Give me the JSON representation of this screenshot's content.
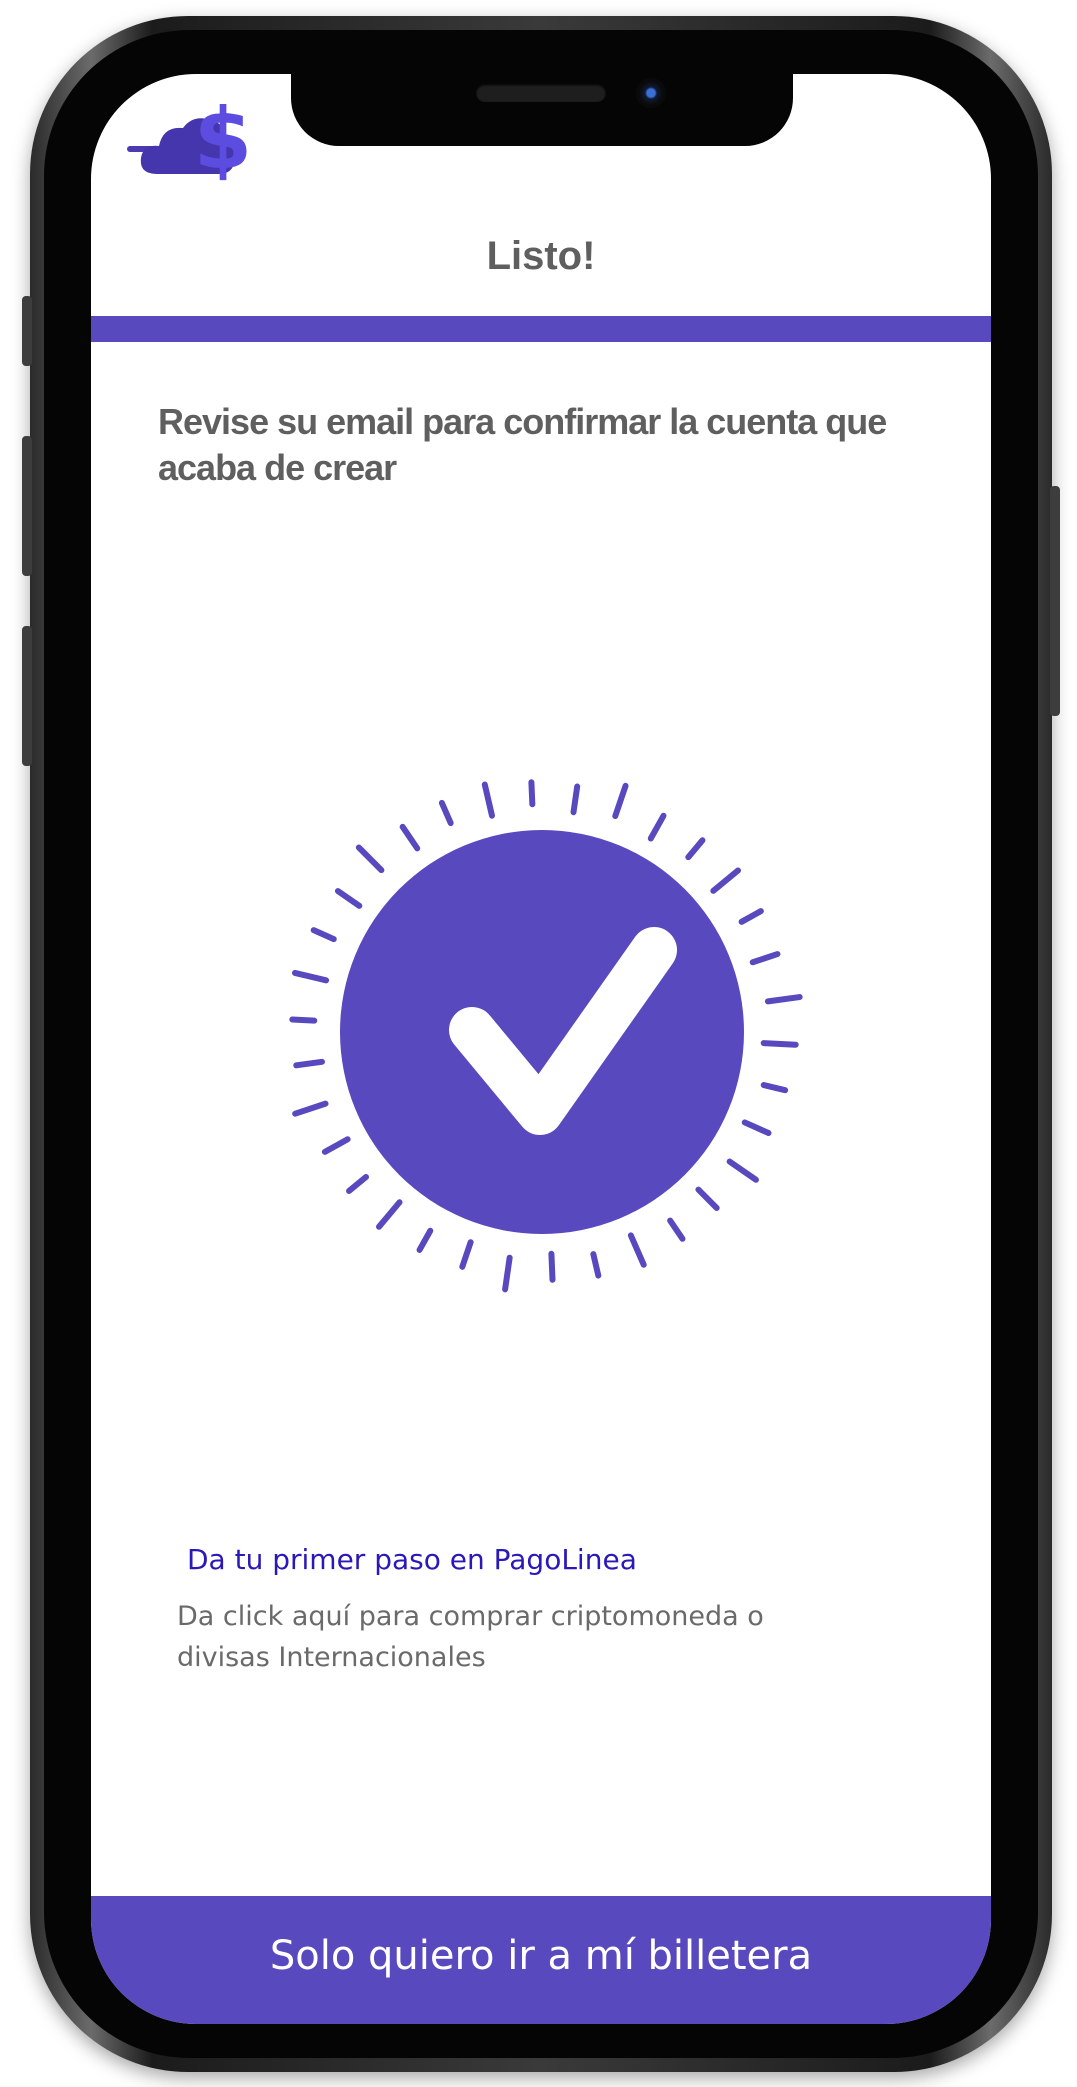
{
  "header": {
    "title": "Listo!",
    "logo_icon": "cloud-dollar-logo-icon"
  },
  "main": {
    "message": "Revise su email para confirmar la cuenta que acaba de crear",
    "success_icon": "check-circle-icon",
    "cta_link": "Da tu primer paso en PagoLinea",
    "cta_description": "Da click aquí para comprar criptomoneda o divisas Internacionales"
  },
  "footer": {
    "wallet_button": "Solo quiero ir a mí billetera"
  },
  "colors": {
    "accent": "#5949bf",
    "link": "#2b18b8",
    "text_gray": "#5f5f5f"
  }
}
